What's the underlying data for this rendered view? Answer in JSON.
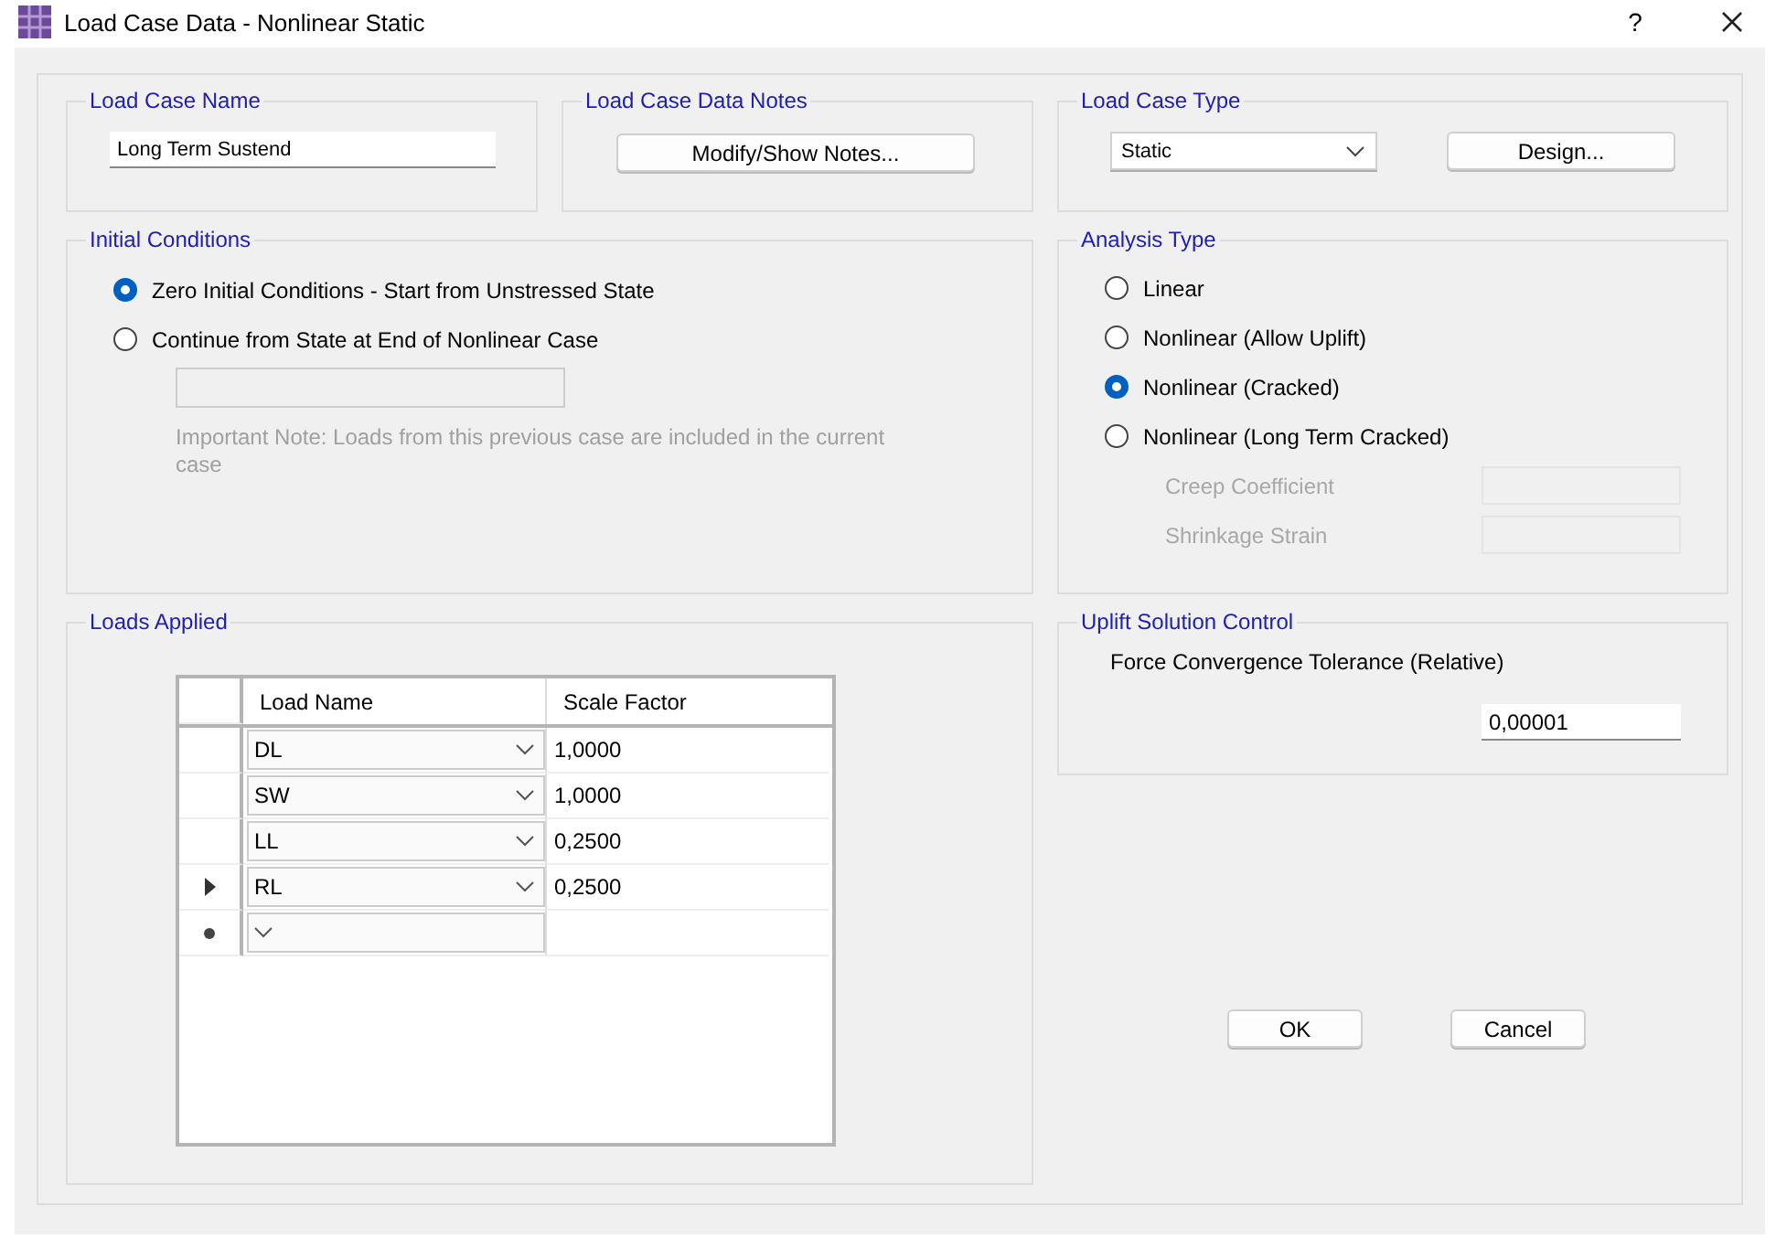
{
  "window": {
    "title": "Load Case Data - Nonlinear Static",
    "help": "?"
  },
  "load_case_name": {
    "title": "Load Case Name",
    "value": "Long Term Sustend"
  },
  "notes": {
    "title": "Load Case Data Notes",
    "button": "Modify/Show Notes..."
  },
  "load_case_type": {
    "title": "Load Case Type",
    "value": "Static",
    "button": "Design..."
  },
  "initial_conditions": {
    "title": "Initial Conditions",
    "options": [
      {
        "label": "Zero Initial Conditions - Start from Unstressed State",
        "selected": true
      },
      {
        "label": "Continue from State at End of Nonlinear Case",
        "selected": false
      }
    ],
    "case_field": {
      "disabled": true
    },
    "note": "Important Note:  Loads from this previous case are included in the current case",
    "note_disabled": true
  },
  "analysis_type": {
    "title": "Analysis Type",
    "options": [
      {
        "label": "Linear",
        "selected": false
      },
      {
        "label": "Nonlinear (Allow Uplift)",
        "selected": false
      },
      {
        "label": "Nonlinear (Cracked)",
        "selected": true
      },
      {
        "label": "Nonlinear (Long Term Cracked)",
        "selected": false
      }
    ],
    "fields": [
      {
        "label": "Creep Coefficient",
        "disabled": true
      },
      {
        "label": "Shrinkage Strain",
        "disabled": true
      }
    ]
  },
  "loads_applied": {
    "title": "Loads Applied",
    "columns": [
      "Load Name",
      "Scale Factor"
    ],
    "rows": [
      {
        "kind": "entry",
        "load_name": "DL",
        "scale_factor": "1,0000",
        "current": false
      },
      {
        "kind": "entry",
        "load_name": "SW",
        "scale_factor": "1,0000",
        "current": false
      },
      {
        "kind": "entry",
        "load_name": "LL",
        "scale_factor": "0,2500",
        "current": false
      },
      {
        "kind": "entry",
        "load_name": "RL",
        "scale_factor": "0,2500",
        "current": true
      },
      {
        "kind": "new",
        "current": false
      }
    ]
  },
  "uplift": {
    "title": "Uplift Solution Control",
    "label": "Force Convergence Tolerance (Relative)",
    "value": "0,00001"
  },
  "buttons": [
    "OK",
    "Cancel"
  ]
}
